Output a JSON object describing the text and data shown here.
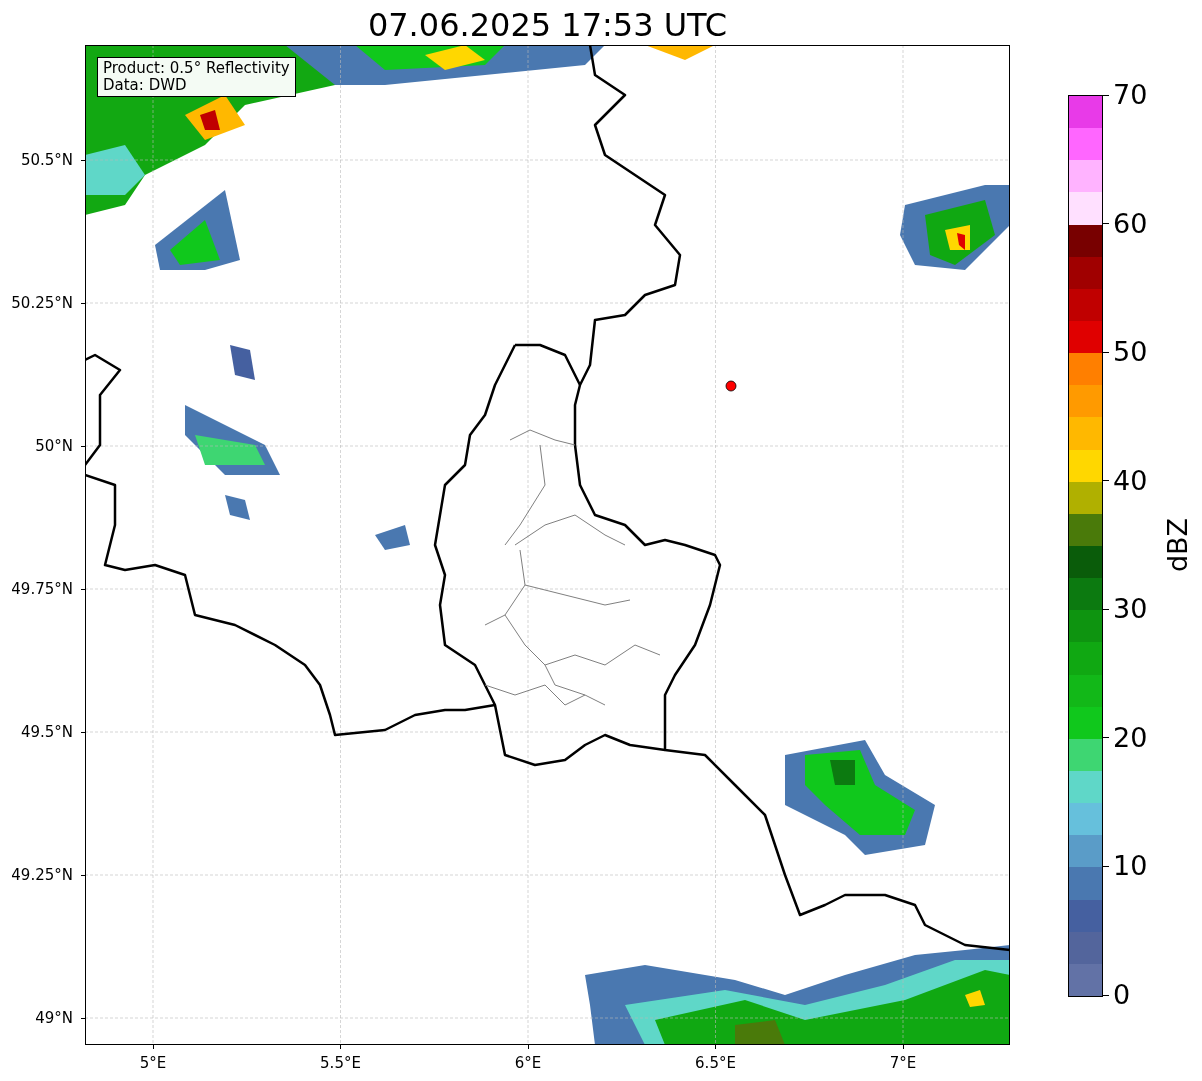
{
  "title": "07.06.2025 17:53 UTC",
  "legend": {
    "lines": [
      "Product: 0.5° Reflectivity",
      "Data: DWD"
    ]
  },
  "y_ticks": [
    "50.5°N",
    "50.25°N",
    "50°N",
    "49.75°N",
    "49.5°N",
    "49.25°N",
    "49°N"
  ],
  "x_ticks": [
    "5°E",
    "5.5°E",
    "6°E",
    "6.5°E",
    "7°E"
  ],
  "colorbar": {
    "label": "dBZ",
    "ticks": [
      "70",
      "60",
      "50",
      "40",
      "30",
      "20",
      "10",
      "0"
    ],
    "segments": [
      {
        "color": "#6272a6"
      },
      {
        "color": "#53659c"
      },
      {
        "color": "#4560a0"
      },
      {
        "color": "#4a78b0"
      },
      {
        "color": "#5a9cc8"
      },
      {
        "color": "#66c0dc"
      },
      {
        "color": "#5fd7c8"
      },
      {
        "color": "#3ed672"
      },
      {
        "color": "#10c81c"
      },
      {
        "color": "#12b818"
      },
      {
        "color": "#10a812"
      },
      {
        "color": "#0e9410"
      },
      {
        "color": "#0c7a10"
      },
      {
        "color": "#0a5c0a"
      },
      {
        "color": "#4a7a0a"
      },
      {
        "color": "#b0b000"
      },
      {
        "color": "#ffd700"
      },
      {
        "color": "#ffb800"
      },
      {
        "color": "#ff9a00"
      },
      {
        "color": "#ff7f00"
      },
      {
        "color": "#e00000"
      },
      {
        "color": "#c00000"
      },
      {
        "color": "#a00000"
      },
      {
        "color": "#780000"
      },
      {
        "color": "#ffe0ff"
      },
      {
        "color": "#ffb3ff"
      },
      {
        "color": "#ff66ff"
      },
      {
        "color": "#e83ae8"
      }
    ]
  }
}
